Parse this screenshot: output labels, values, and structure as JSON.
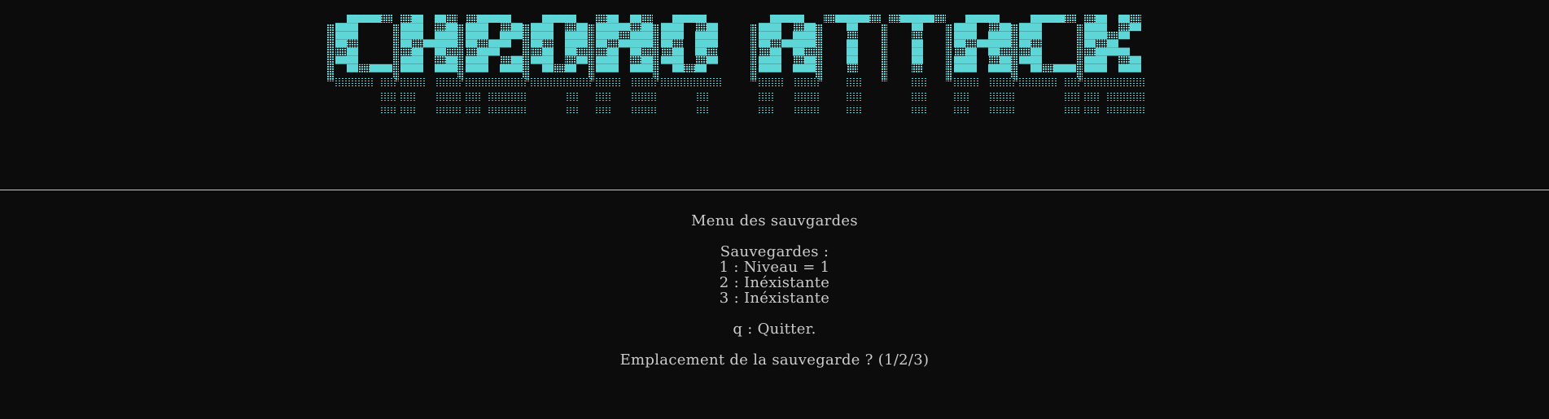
{
  "banner": {
    "title_art": "CHRONO ATTACK",
    "color": "#5cd6d6"
  },
  "menu": {
    "title": "Menu des sauvgardes",
    "saves_header": "Sauvegardes :",
    "saves": [
      "1 : Niveau = 1",
      "2 : Inéxistante",
      "3 : Inéxistante"
    ],
    "quit_option": "q : Quitter.",
    "prompt": "Emplacement de la sauvegarde ? (1/2/3)"
  },
  "colors": {
    "background": "#0c0c0c",
    "text": "#cccccc",
    "accent": "#5cd6d6"
  }
}
